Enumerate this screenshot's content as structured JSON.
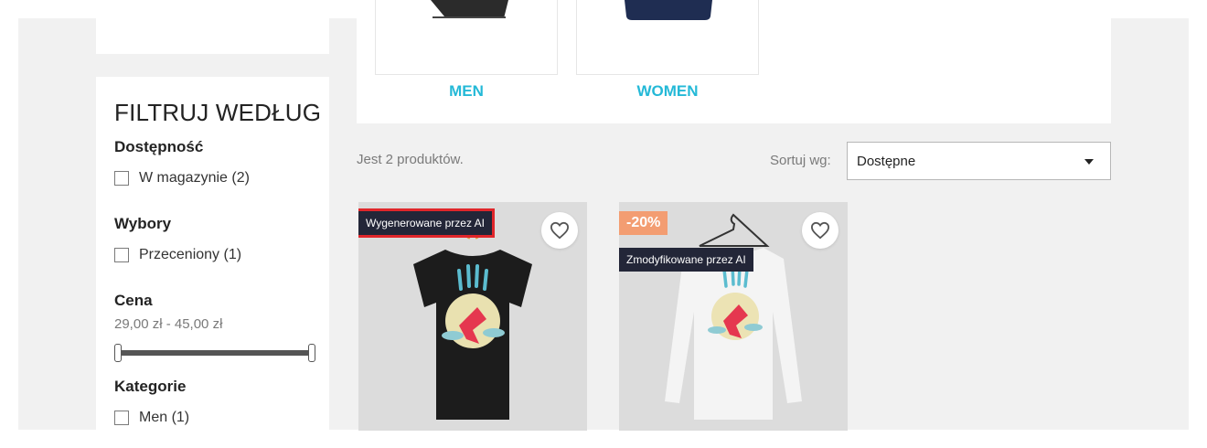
{
  "filters": {
    "title": "FILTRUJ WEDŁUG",
    "availability": {
      "title": "Dostępność",
      "options": [
        {
          "label": "W magazynie (2)",
          "checked": false
        }
      ]
    },
    "selections": {
      "title": "Wybory",
      "options": [
        {
          "label": "Przeceniony (1)",
          "checked": false
        }
      ]
    },
    "price": {
      "title": "Cena",
      "range_text": "29,00 zł - 45,00 zł",
      "min": 29,
      "max": 45,
      "selected_min": 29,
      "selected_max": 45
    },
    "categories": {
      "title": "Kategorie",
      "options": [
        {
          "label": "Men (1)",
          "checked": false
        }
      ]
    }
  },
  "categories_row": {
    "items": [
      {
        "label": "MEN"
      },
      {
        "label": "WOMEN"
      }
    ]
  },
  "listing": {
    "count_text": "Jest 2 produktów.",
    "sort_label": "Sortuj wg:",
    "sort_value": "Dostępne"
  },
  "products": [
    {
      "ai_badge": "Wygenerowane przez AI",
      "discount": "",
      "shirt_color": "#1c1c1c",
      "wishlist_icon": "heart-outline-icon"
    },
    {
      "ai_badge": "Zmodyfikowane przez AI",
      "discount": "-20%",
      "shirt_color": "#f4f4f4",
      "wishlist_icon": "heart-outline-icon"
    }
  ],
  "colors": {
    "accent": "#24b9d7",
    "badge_dark": "#232638",
    "discount": "#f39d72",
    "highlight": "#e0262b"
  }
}
